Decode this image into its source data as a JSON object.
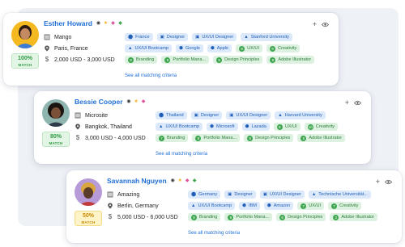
{
  "cards": [
    {
      "name": "Esther Howard",
      "match_pct": "100%",
      "match_label": "MATCH",
      "match_color": "green",
      "company": "Mango",
      "location": "Paris, France",
      "salary": "2,000 USD - 3,000 USD",
      "chip_rows": [
        [
          {
            "icon": "location-pin-icon",
            "text": "France",
            "color": "blue"
          },
          {
            "icon": "briefcase-icon",
            "text": "Designer",
            "color": "blue"
          },
          {
            "icon": "briefcase-icon",
            "text": "UX/UI Designer",
            "color": "blue"
          },
          {
            "icon": "school-icon",
            "text": "Stanford University",
            "color": "blue"
          }
        ],
        [
          {
            "icon": "school-icon",
            "text": "UX/UI Bootcamp",
            "color": "blue"
          },
          {
            "icon": "people-icon",
            "text": "Google",
            "color": "blue"
          },
          {
            "icon": "people-icon",
            "text": "Apple",
            "color": "blue"
          },
          {
            "num": "9",
            "text": "UX/UI",
            "color": "green"
          },
          {
            "num": "9",
            "text": "Creativity",
            "color": "green"
          }
        ],
        [
          {
            "num": "9",
            "text": "Branding",
            "color": "green"
          },
          {
            "num": "9",
            "text": "Portfolio Mana...",
            "color": "green"
          },
          {
            "num": "9",
            "text": "Design Principles",
            "color": "green"
          },
          {
            "num": "9",
            "text": "Adobe Illustrator",
            "color": "green"
          }
        ]
      ]
    },
    {
      "name": "Bessie Cooper",
      "match_pct": "80%",
      "match_label": "MATCH",
      "match_color": "green",
      "company": "Microsite",
      "location": "Bangkok, Thailand",
      "salary": "3,000 USD - 4,000 USD",
      "chip_rows": [
        [
          {
            "icon": "location-pin-icon",
            "text": "Thailand",
            "color": "blue"
          },
          {
            "icon": "briefcase-icon",
            "text": "Designer",
            "color": "blue"
          },
          {
            "icon": "briefcase-icon",
            "text": "UX/UI Designer",
            "color": "blue"
          },
          {
            "icon": "school-icon",
            "text": "Harvard University",
            "color": "blue"
          }
        ],
        [
          {
            "icon": "school-icon",
            "text": "UX/UI Bootcamp",
            "color": "blue"
          },
          {
            "icon": "people-icon",
            "text": "Microsoft",
            "color": "blue"
          },
          {
            "icon": "people-icon",
            "text": "Lazada",
            "color": "blue"
          },
          {
            "num": "8",
            "text": "UX/UI",
            "color": "green"
          },
          {
            "num": "10",
            "text": "Creativity",
            "color": "green"
          }
        ],
        [
          {
            "num": "7",
            "text": "Branding",
            "color": "green"
          },
          {
            "num": "8",
            "text": "Portfolio Mana...",
            "color": "green"
          },
          {
            "num": "8",
            "text": "Design Principles",
            "color": "green"
          },
          {
            "num": "5",
            "text": "Adobe Illustrator",
            "color": "green"
          }
        ]
      ]
    },
    {
      "name": "Savannah Nguyen",
      "match_pct": "50%",
      "match_label": "MATCH",
      "match_color": "yellow",
      "company": "Amazing",
      "location": "Berlin, Germany",
      "salary": "5,000 USD - 6,000 USD",
      "chip_rows": [
        [
          {
            "icon": "location-pin-icon",
            "text": "Germany",
            "color": "blue"
          },
          {
            "icon": "briefcase-icon",
            "text": "Designer",
            "color": "blue"
          },
          {
            "icon": "briefcase-icon",
            "text": "UX/UI Designer",
            "color": "blue"
          },
          {
            "icon": "school-icon",
            "text": "Technische Universität...",
            "color": "blue"
          }
        ],
        [
          {
            "icon": "school-icon",
            "text": "UX/UI Bootcamp",
            "color": "blue"
          },
          {
            "icon": "people-icon",
            "text": "IBM",
            "color": "blue"
          },
          {
            "icon": "people-icon",
            "text": "Amazon",
            "color": "blue"
          },
          {
            "num": "7",
            "text": "UX/UI",
            "color": "green"
          },
          {
            "num": "7",
            "text": "Creativity",
            "color": "green"
          }
        ],
        [
          {
            "num": "9",
            "text": "Branding",
            "color": "green"
          },
          {
            "num": "9",
            "text": "Portfolio Mana...",
            "color": "green"
          },
          {
            "num": "6",
            "text": "Design Principles",
            "color": "green"
          },
          {
            "num": "2",
            "text": "Adobe Illustrator",
            "color": "green"
          }
        ]
      ]
    }
  ],
  "see_all_label": "See all matching criteria",
  "icons": {
    "add": "+",
    "view": "👁"
  },
  "colors": {
    "name": "#1f6fd6",
    "chip_blue_bg": "#dce9fb",
    "chip_green_bg": "#dcf1df",
    "match_green": "#2f9a43",
    "match_yellow": "#c98a05"
  }
}
